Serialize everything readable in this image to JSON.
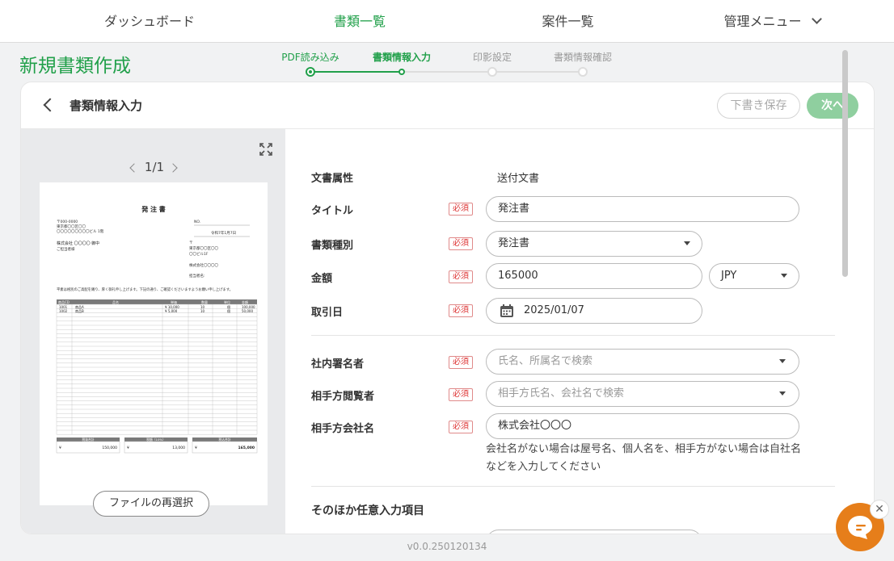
{
  "nav": {
    "items": [
      {
        "label": "ダッシュボード"
      },
      {
        "label": "書類一覧"
      },
      {
        "label": "案件一覧"
      },
      {
        "label": "管理メニュー"
      }
    ]
  },
  "page_title": "新規書類作成",
  "stepper": {
    "steps": [
      {
        "label": "PDF読み込み",
        "state": "done"
      },
      {
        "label": "書類情報入力",
        "state": "current"
      },
      {
        "label": "印影設定",
        "state": "pending"
      },
      {
        "label": "書類情報確認",
        "state": "pending"
      }
    ]
  },
  "card": {
    "title": "書類情報入力",
    "draft_label": "下書き保存",
    "next_label": "次へ"
  },
  "preview": {
    "page_indicator": "1/1",
    "reselect_label": "ファイルの再選択",
    "doc": {
      "heading": "発 注 書",
      "addr1": "〒000-0000",
      "addr2": "東京都〇〇区〇〇",
      "addr3": "〇〇〇〇〇〇〇〇〇ビル 1階",
      "no_label": "NO.",
      "date": "令和7年1月7日",
      "to": "株式会社 〇〇〇〇 御中",
      "to2": "ご担当者様",
      "from1": "〒",
      "from2": "東京都〇〇区〇〇",
      "from3": "〇〇ビル1F",
      "from4": "株式会社〇〇〇〇",
      "from5": "担当者名:",
      "intro": "平素は格別のご高配を賜り、厚く御礼申し上げます。下記の通り、ご確認くださいますようお願い申し上げます。",
      "table_headers": [
        "商品CD",
        "品名",
        "単価",
        "数量",
        "単位",
        "金額"
      ],
      "rows": [
        [
          "1001",
          "商品A",
          "¥ 10,000",
          "10",
          "個",
          "100,000"
        ],
        [
          "1002",
          "商品B",
          "¥ 5,000",
          "10",
          "個",
          "50,000"
        ]
      ],
      "totals": [
        {
          "label": "税抜合計",
          "value": "150,000"
        },
        {
          "label": "税額（10%）",
          "value": "13,000"
        },
        {
          "label": "税込合計",
          "value": "165,000"
        }
      ]
    }
  },
  "form": {
    "doc_attr": {
      "label": "文書属性",
      "value": "送付文書"
    },
    "title": {
      "label": "タイトル",
      "value": "発注書"
    },
    "doc_type": {
      "label": "書類種別",
      "value": "発注書"
    },
    "amount": {
      "label": "金額",
      "value": "165000",
      "currency": "JPY"
    },
    "trade_date": {
      "label": "取引日",
      "value": "2025/01/07"
    },
    "internal_signer": {
      "label": "社内署名者",
      "placeholder": "氏名、所属名で検索"
    },
    "counterparty_viewer": {
      "label": "相手方閲覧者",
      "placeholder": "相手方氏名、会社名で検索"
    },
    "counterparty_company": {
      "label": "相手方会社名",
      "value": "株式会社〇〇〇",
      "hint": "会社名がない場合は屋号名、個人名を、相手方がない場合は自社名などを入力してください"
    },
    "required_label": "必須",
    "optional_section": "そのほか任意入力項目"
  },
  "version": "v0.0.250120134",
  "colors": {
    "accent": "#21a04a",
    "chat": "#e67e1a"
  }
}
